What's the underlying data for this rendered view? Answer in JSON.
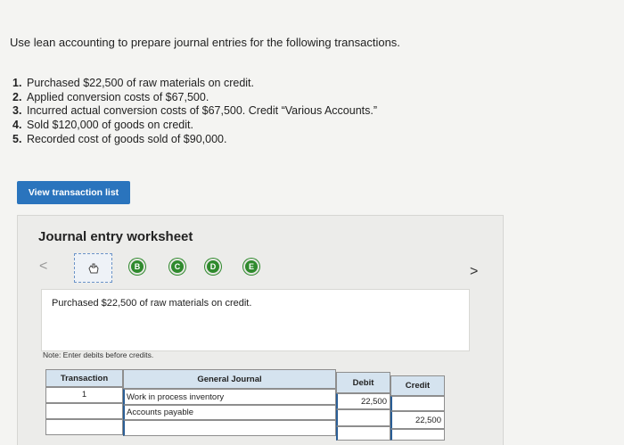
{
  "question": "Use lean accounting to prepare journal entries for the following transactions.",
  "transactions": [
    {
      "num": "1.",
      "text": "Purchased $22,500 of raw materials on credit."
    },
    {
      "num": "2.",
      "text": "Applied conversion costs of $67,500."
    },
    {
      "num": "3.",
      "text": "Incurred actual conversion costs of $67,500. Credit “Various Accounts.”"
    },
    {
      "num": "4.",
      "text": "Sold $120,000 of goods on credit."
    },
    {
      "num": "5.",
      "text": "Recorded cost of goods sold of $90,000."
    }
  ],
  "view_button": "View transaction list",
  "worksheet": {
    "title": "Journal entry worksheet",
    "nav_prev": "<",
    "nav_next": ">",
    "current_step_icon": "hand-pointer-icon",
    "steps": [
      "B",
      "C",
      "D",
      "E"
    ],
    "description": "Purchased $22,500 of raw materials on credit.",
    "note": "Note: Enter debits before credits."
  },
  "journal": {
    "headers": {
      "transaction": "Transaction",
      "general_journal": "General Journal",
      "debit": "Debit",
      "credit": "Credit"
    },
    "rows": [
      {
        "transaction": "1",
        "account": "Work in process inventory",
        "debit": "22,500",
        "credit": ""
      },
      {
        "transaction": "",
        "account": "Accounts payable",
        "debit": "",
        "credit": "22,500"
      },
      {
        "transaction": "",
        "account": "",
        "debit": "",
        "credit": ""
      }
    ]
  },
  "colors": {
    "accent": "#2a74bd",
    "step_green": "#2f8a2d",
    "header_bg": "#d5e3ef"
  }
}
